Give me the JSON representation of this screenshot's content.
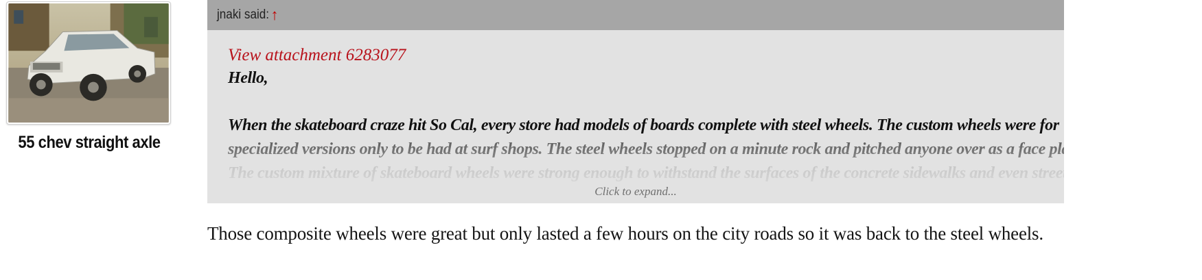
{
  "user": {
    "avatar_icon": "car-photo-avatar",
    "title": "55 chev straight axle"
  },
  "quote": {
    "author_label": "jnaki said:",
    "jump_icon": "↑",
    "attachment_link": "View attachment 6283077",
    "greeting": "Hello,",
    "lines": [
      "When the skateboard craze hit So Cal, every store had models of boards complete with steel wheels. The custom wheels were for",
      "specialized versions only to be had at surf shops. The steel wheels stopped on a minute rock and pitched anyone over as a face plant.",
      "The custom mixture of skateboard wheels were strong enough to withstand the surfaces of the concrete sidewalks and even streets."
    ],
    "expand_label": "Click to expand..."
  },
  "reply": {
    "text": "Those composite wheels were great but only lasted a few hours on the city roads so it was back to the steel wheels."
  },
  "colors": {
    "quote_bg": "#e2e2e2",
    "quote_header_bg": "#a6a6a6",
    "link": "#b8121b",
    "arrow": "#c00000"
  }
}
